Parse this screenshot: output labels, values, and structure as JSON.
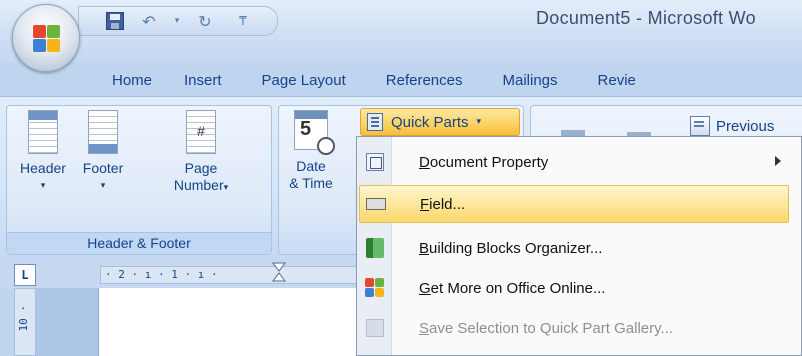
{
  "window": {
    "title": "Document5 - Microsoft Wo"
  },
  "tabs": [
    "Home",
    "Insert",
    "Page Layout",
    "References",
    "Mailings",
    "Revie"
  ],
  "ribbon": {
    "header_footer_group": {
      "label": "Header & Footer",
      "header_label": "Header",
      "footer_label": "Footer",
      "page_number_line1": "Page",
      "page_number_line2": "Number",
      "dropdown_arrow": "▾"
    },
    "text_group": {
      "date_line1": "Date",
      "date_line2": "& Time",
      "calendar_number": "5"
    },
    "quick_parts_label": "Quick Parts",
    "quick_parts_arrow": "▾",
    "previous_label": "Previous"
  },
  "ruler": {
    "corner": "L",
    "ticks": "· 2 · ı · 1 · ı ·",
    "left_text": "10 ·"
  },
  "menu": {
    "items": [
      {
        "mnemonic": "D",
        "rest": "ocument Property",
        "has_submenu": true,
        "state": "normal"
      },
      {
        "mnemonic": "F",
        "rest": "ield...",
        "has_submenu": false,
        "state": "hover"
      },
      {
        "mnemonic": "B",
        "rest": "uilding Blocks Organizer...",
        "has_submenu": false,
        "state": "normal"
      },
      {
        "mnemonic": "G",
        "rest": "et More on Office Online...",
        "has_submenu": false,
        "state": "normal"
      },
      {
        "mnemonic": "S",
        "rest": "ave Selection to Quick Part Gallery...",
        "has_submenu": false,
        "state": "disabled"
      }
    ]
  },
  "colors": {
    "accent": "#15428b",
    "hover": "#fcd86b",
    "office_red": "#e4472f",
    "office_green": "#6cb33e",
    "office_blue": "#3d7fd1",
    "office_yellow": "#f5b51a"
  }
}
